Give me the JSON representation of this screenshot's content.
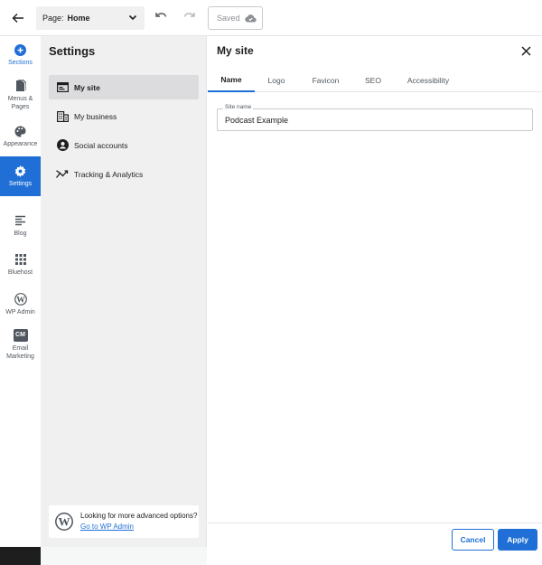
{
  "topbar": {
    "page_label": "Page:",
    "page_value": "Home",
    "saved_label": "Saved"
  },
  "rail": {
    "items": [
      {
        "label": "Sections",
        "icon": "plus-circle-icon"
      },
      {
        "label": "Menus & Pages",
        "icon": "pages-icon"
      },
      {
        "label": "Appearance",
        "icon": "palette-icon"
      },
      {
        "label": "Settings",
        "icon": "gear-icon"
      },
      {
        "label": "Blog",
        "icon": "blog-icon"
      },
      {
        "label": "Bluehost",
        "icon": "grid-icon"
      },
      {
        "label": "WP Admin",
        "icon": "wordpress-icon"
      },
      {
        "label": "Email Marketing",
        "icon": "cm-icon",
        "badge": "CM"
      }
    ]
  },
  "settings": {
    "title": "Settings",
    "items": [
      {
        "label": "My site",
        "icon": "browser-icon"
      },
      {
        "label": "My business",
        "icon": "building-icon"
      },
      {
        "label": "Social accounts",
        "icon": "user-circle-icon"
      },
      {
        "label": "Tracking & Analytics",
        "icon": "trending-icon"
      }
    ],
    "wp_card": {
      "text": "Looking for more advanced options?",
      "link": "Go to WP Admin"
    }
  },
  "main": {
    "title": "My site",
    "tabs": [
      {
        "label": "Name"
      },
      {
        "label": "Logo"
      },
      {
        "label": "Favicon"
      },
      {
        "label": "SEO"
      },
      {
        "label": "Accessibility"
      }
    ],
    "site_name": {
      "label": "Site name",
      "value": "Podcast Example"
    },
    "cancel_label": "Cancel",
    "apply_label": "Apply"
  },
  "colors": {
    "accent": "#1f6fd6",
    "panel_bg": "#f0f0f0",
    "active_item_bg": "#dcdcde"
  }
}
